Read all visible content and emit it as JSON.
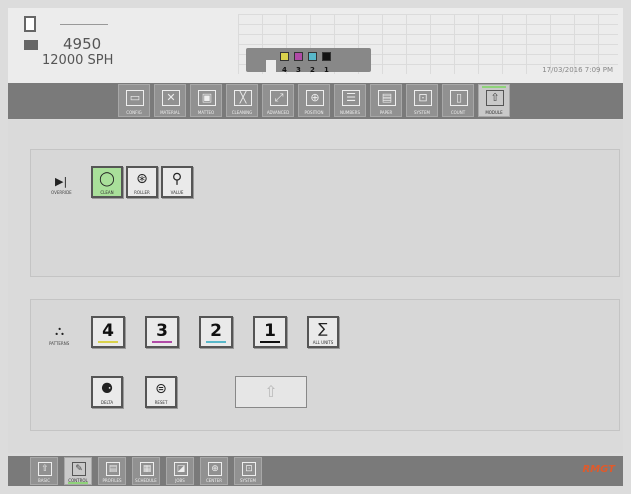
{
  "header": {
    "counter": "4950",
    "speed": "12000 SPH",
    "datetime": "17/03/2016 7:09 PM",
    "units": [
      {
        "num": "4",
        "color": "#d9d24c"
      },
      {
        "num": "3",
        "color": "#b04aa6"
      },
      {
        "num": "2",
        "color": "#58b7c9"
      },
      {
        "num": "1",
        "color": "#111111"
      }
    ]
  },
  "top_nav": [
    {
      "label": "CONFIG",
      "icon": "▭"
    },
    {
      "label": "MATERIAL",
      "icon": "✕"
    },
    {
      "label": "MATTEO",
      "icon": "▣"
    },
    {
      "label": "CLEANING",
      "icon": "╳"
    },
    {
      "label": "ADVANCED",
      "icon": "⤢"
    },
    {
      "label": "POSITION",
      "icon": "⊕"
    },
    {
      "label": "NUMBERS",
      "icon": "☰"
    },
    {
      "label": "PAPER",
      "icon": "▤"
    },
    {
      "label": "SYSTEM",
      "icon": "⊡"
    },
    {
      "label": "COUNT",
      "icon": "▯"
    },
    {
      "label": "MODULE",
      "icon": "⇧",
      "active": true
    }
  ],
  "panel1": {
    "left_label": "OVERRIDE",
    "left_icon": "▶|",
    "buttons": [
      {
        "label": "CLEAN",
        "icon": "◯",
        "active": true
      },
      {
        "label": "ROLLER",
        "icon": "⊛"
      },
      {
        "label": "VALUE",
        "icon": "⚲"
      }
    ]
  },
  "panel2": {
    "left_label": "PATTERNS",
    "left_icon": "⛬",
    "units": [
      {
        "num": "4",
        "color": "#d9d24c"
      },
      {
        "num": "3",
        "color": "#b04aa6"
      },
      {
        "num": "2",
        "color": "#58b7c9"
      },
      {
        "num": "1",
        "color": "#111111"
      }
    ],
    "sum_label": "ALL UNITS",
    "sum_icon": "∑",
    "row2": [
      {
        "label": "DELTA",
        "icon": "⚈"
      },
      {
        "label": "RESET",
        "icon": "⊜"
      }
    ],
    "disabled_icon": "⇧"
  },
  "bottom_nav": [
    {
      "label": "BASIC",
      "icon": "⇧"
    },
    {
      "label": "CONTROL",
      "icon": "✎",
      "active": true
    },
    {
      "label": "PROFILES",
      "icon": "▤"
    },
    {
      "label": "SCHEDULE",
      "icon": "▦"
    },
    {
      "label": "JOBS",
      "icon": "◪"
    },
    {
      "label": "CENTER",
      "icon": "⊕"
    },
    {
      "label": "SYSTEM",
      "icon": "⊡"
    }
  ],
  "brand": "RMGT"
}
